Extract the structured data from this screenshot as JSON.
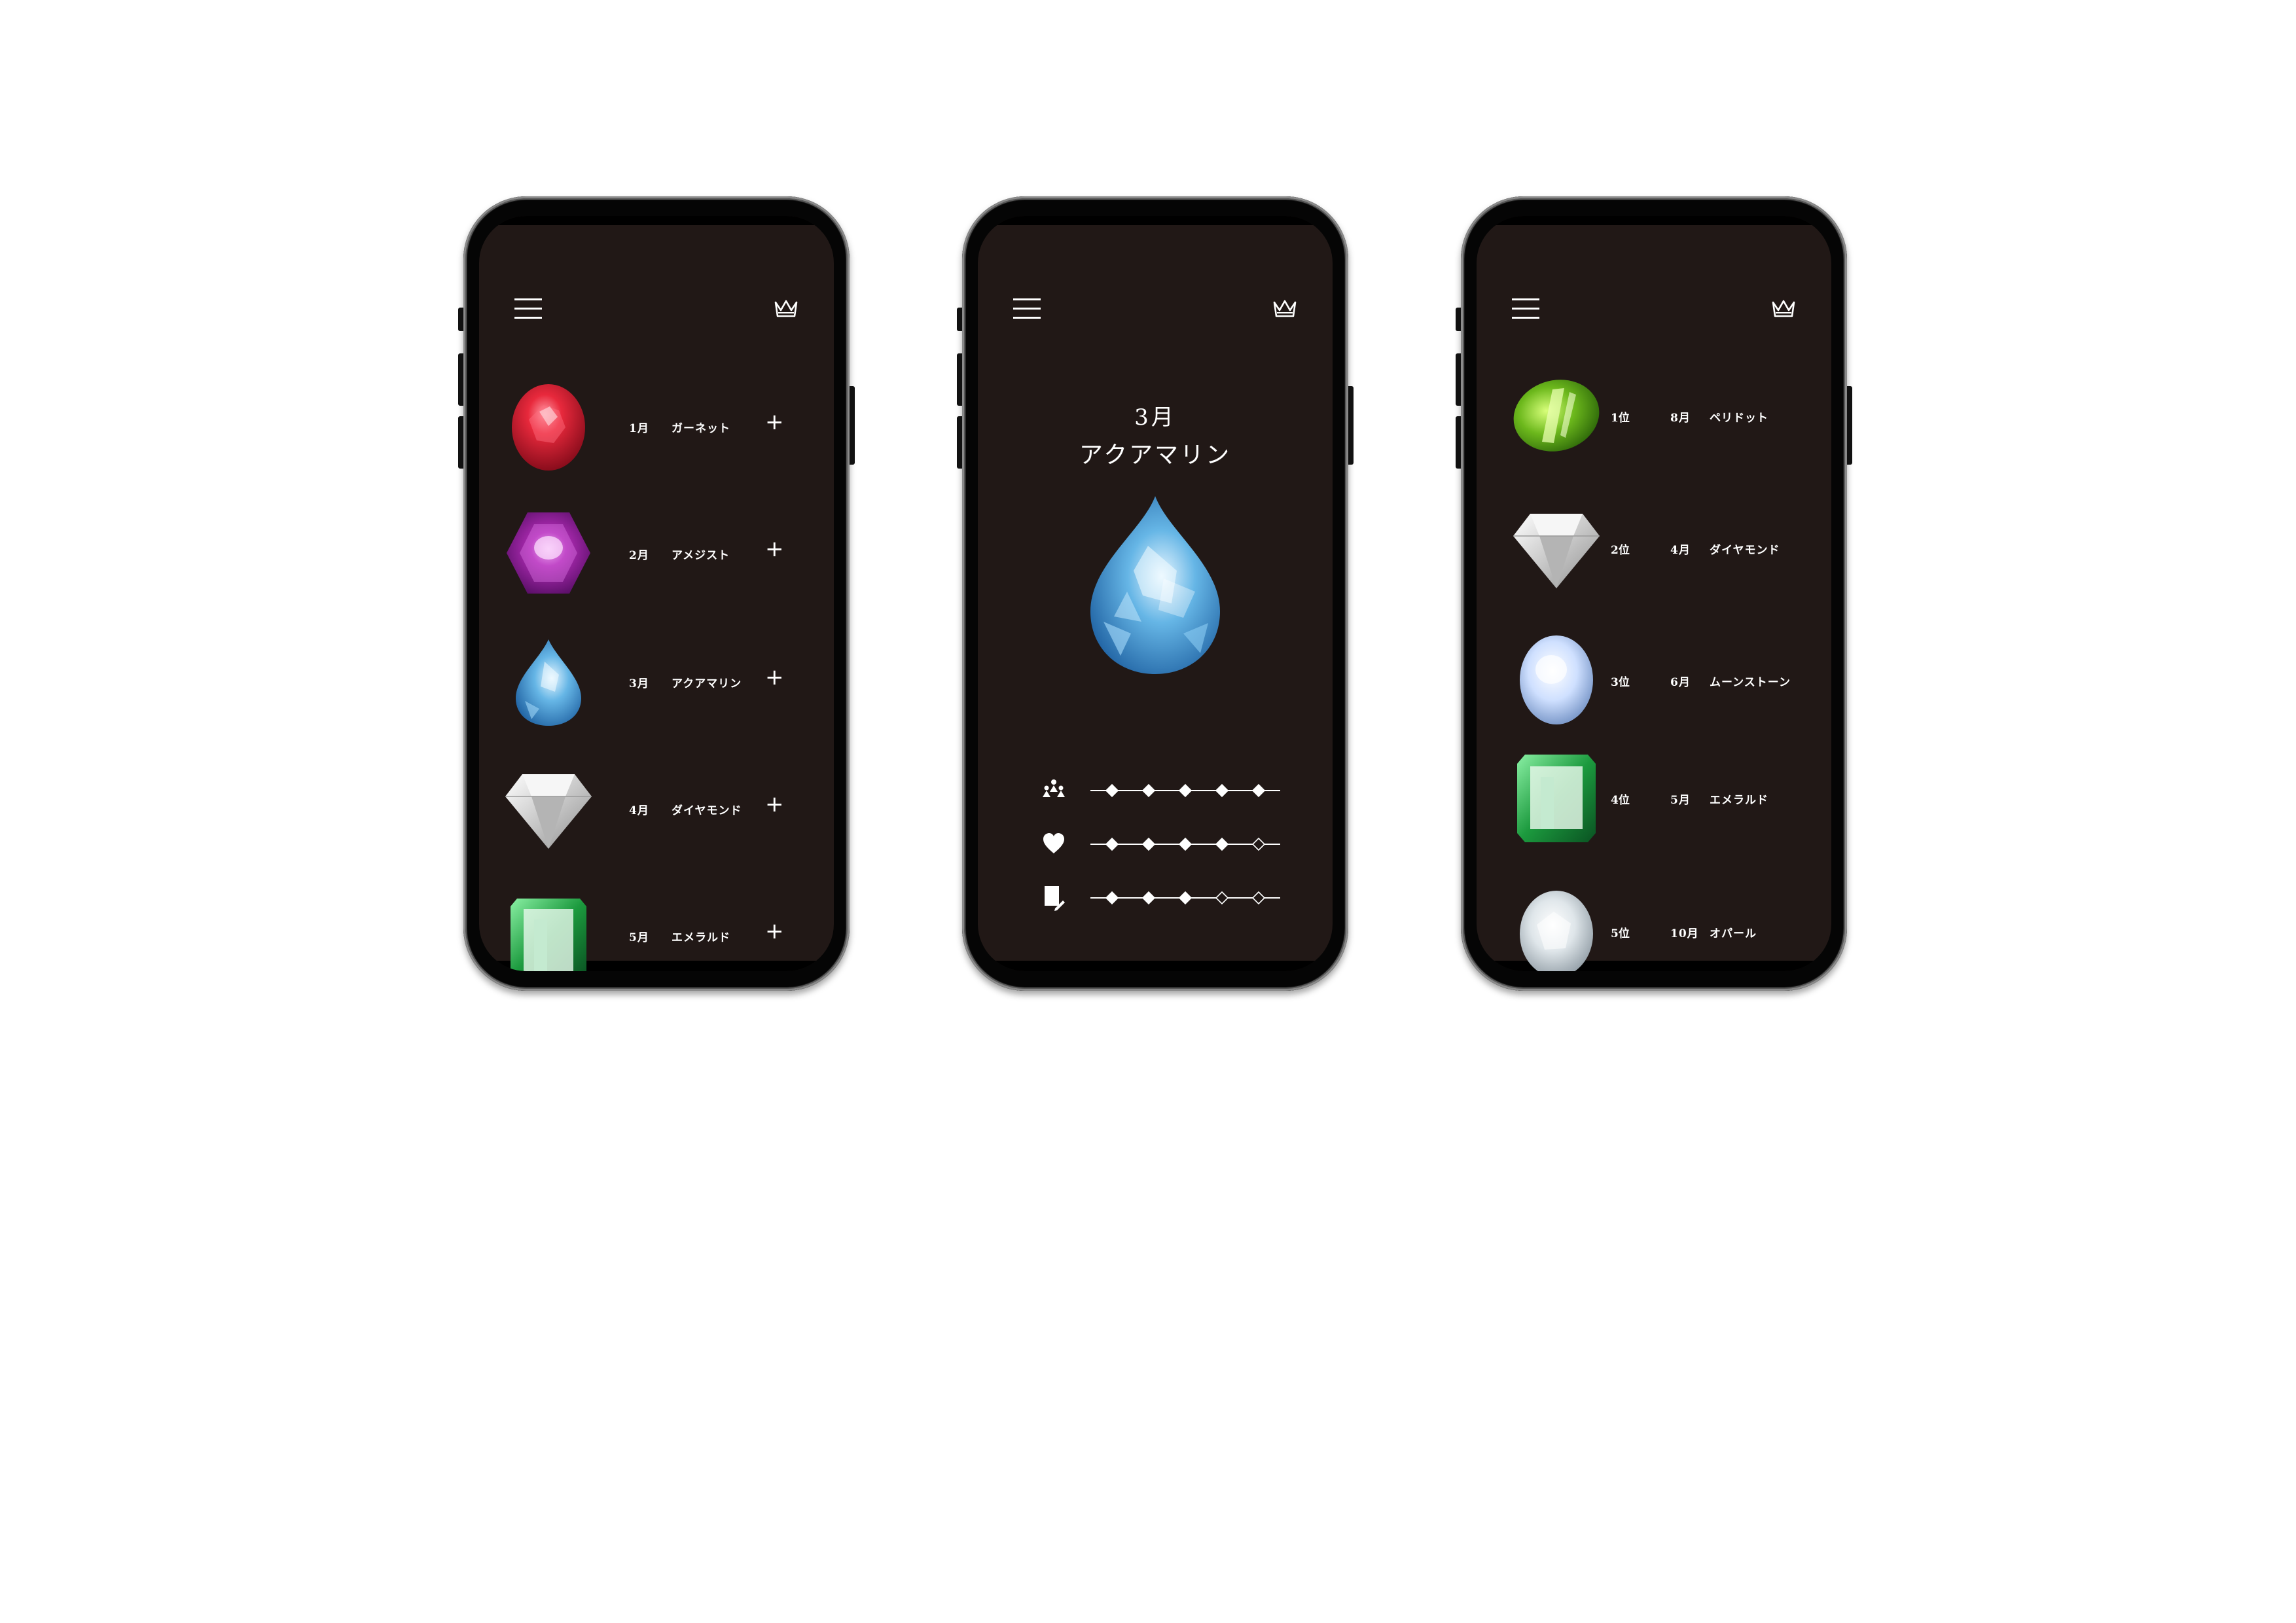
{
  "icons": {
    "menu": "menu-icon",
    "crown": "crown-icon",
    "plus": "plus-icon"
  },
  "colors": {
    "screen_bg": "#211816",
    "text": "#ffffff"
  },
  "list_screen": {
    "items": [
      {
        "month": "1月",
        "name": "ガーネット",
        "action": "+",
        "gem": "garnet"
      },
      {
        "month": "2月",
        "name": "アメジスト",
        "action": "+",
        "gem": "amethyst"
      },
      {
        "month": "3月",
        "name": "アクアマリン",
        "action": "+",
        "gem": "aquamarine"
      },
      {
        "month": "4月",
        "name": "ダイヤモンド",
        "action": "+",
        "gem": "diamond"
      },
      {
        "month": "5月",
        "name": "エメラルド",
        "action": "+",
        "gem": "emerald"
      }
    ]
  },
  "detail_screen": {
    "month": "3月",
    "name": "アクアマリン",
    "ratings": [
      {
        "icon": "people-icon",
        "value": 5,
        "max": 5
      },
      {
        "icon": "heart-icon",
        "value": 4,
        "max": 5
      },
      {
        "icon": "note-edit-icon",
        "value": 3,
        "max": 5
      }
    ]
  },
  "ranking_screen": {
    "items": [
      {
        "rank": "1位",
        "month": "8月",
        "name": "ペリドット",
        "gem": "peridot"
      },
      {
        "rank": "2位",
        "month": "4月",
        "name": "ダイヤモンド",
        "gem": "diamond"
      },
      {
        "rank": "3位",
        "month": "6月",
        "name": "ムーンストーン",
        "gem": "moonstone"
      },
      {
        "rank": "4位",
        "month": "5月",
        "name": "エメラルド",
        "gem": "emerald"
      },
      {
        "rank": "5位",
        "month": "10月",
        "name": "オパール",
        "gem": "opal"
      }
    ]
  }
}
